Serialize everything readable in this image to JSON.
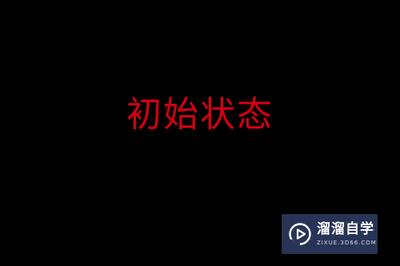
{
  "main": {
    "headline": "初始状态",
    "headline_color": "#d4000f",
    "background_color": "#000000"
  },
  "watermark": {
    "icon": "play-circle-logo-icon",
    "title": "溜溜自学",
    "url": "ZIXUE.3D66.COM",
    "background_color": "#2a385c"
  }
}
